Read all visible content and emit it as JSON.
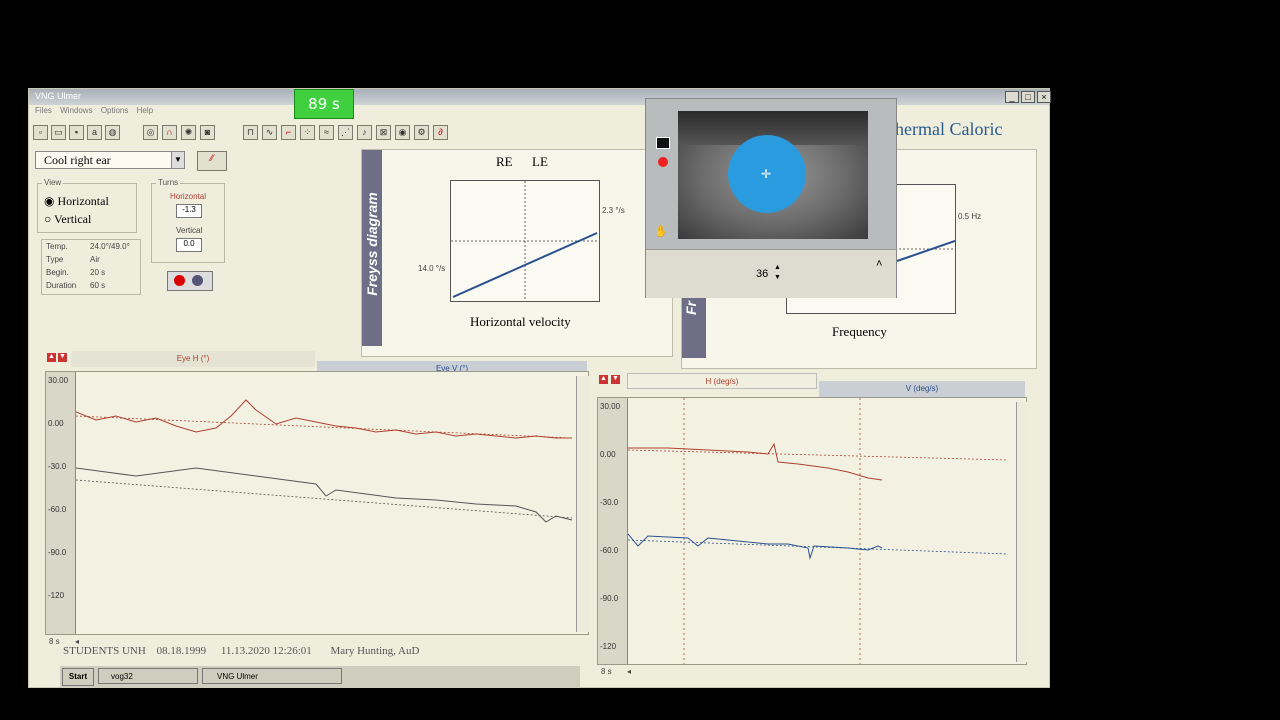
{
  "window": {
    "title": "VNG Ulmer",
    "menu": [
      "Files",
      "Windows",
      "Options",
      "Help"
    ],
    "min": "_",
    "max": "□",
    "close": "×"
  },
  "timer": "89 s",
  "test_select": "Cool right ear",
  "view": {
    "label": "View",
    "horizontal": "Horizontal",
    "vertical": "Vertical",
    "selected": "Horizontal"
  },
  "turns": {
    "label": "Turns",
    "horizontal_label": "Horizontal",
    "horizontal_value": "-1.3",
    "vertical_label": "Vertical",
    "vertical_value": "0.0"
  },
  "params": [
    {
      "k": "Temp.",
      "v": "24.0°/49.0°"
    },
    {
      "k": "Type",
      "v": "Air"
    },
    {
      "k": "Begin.",
      "v": "20 s"
    },
    {
      "k": "Duration",
      "v": "60 s"
    }
  ],
  "freyss": {
    "band": "Freyss diagram",
    "re": "RE",
    "le": "LE",
    "right_label": "2.3 °/s",
    "left_label": "14.0 °/s",
    "xlabel": "Horizontal velocity"
  },
  "thermal": {
    "title": "hermal Caloric",
    "band": "Fr",
    "right_label": "0.5 Hz",
    "xlabel": "Frequency"
  },
  "eye_popup": {
    "value": "36",
    "up": "▲",
    "down": "▼",
    "collapse": "˄"
  },
  "left_trace": {
    "tab_h": "Eye H (°)",
    "tab_v": "Eye V (°)",
    "ticks": [
      "30.00",
      "0.00",
      "-30.0",
      "-60.0",
      "-90.0",
      "-120"
    ],
    "time": "8 s"
  },
  "right_trace": {
    "tab_h": "H (deg/s)",
    "tab_v": "V (deg/s)",
    "ticks": [
      "30.00",
      "0.00",
      "-30.0",
      "-60.0",
      "-90.0",
      "-120"
    ],
    "time": "8 s"
  },
  "status": {
    "patient": "STUDENTS UNH",
    "dob": "08.18.1999",
    "date": "11.13.2020 12:26:01",
    "examiner": "Mary Hunting, AuD"
  },
  "taskbar": {
    "start": "Start",
    "item1": "vog32",
    "item2": "VNG Ulmer"
  },
  "colors": {
    "timer": "#3fcf3f",
    "pupil": "#2b9be0",
    "trace_red": "#b04030",
    "trace_blue": "#2a5090"
  }
}
